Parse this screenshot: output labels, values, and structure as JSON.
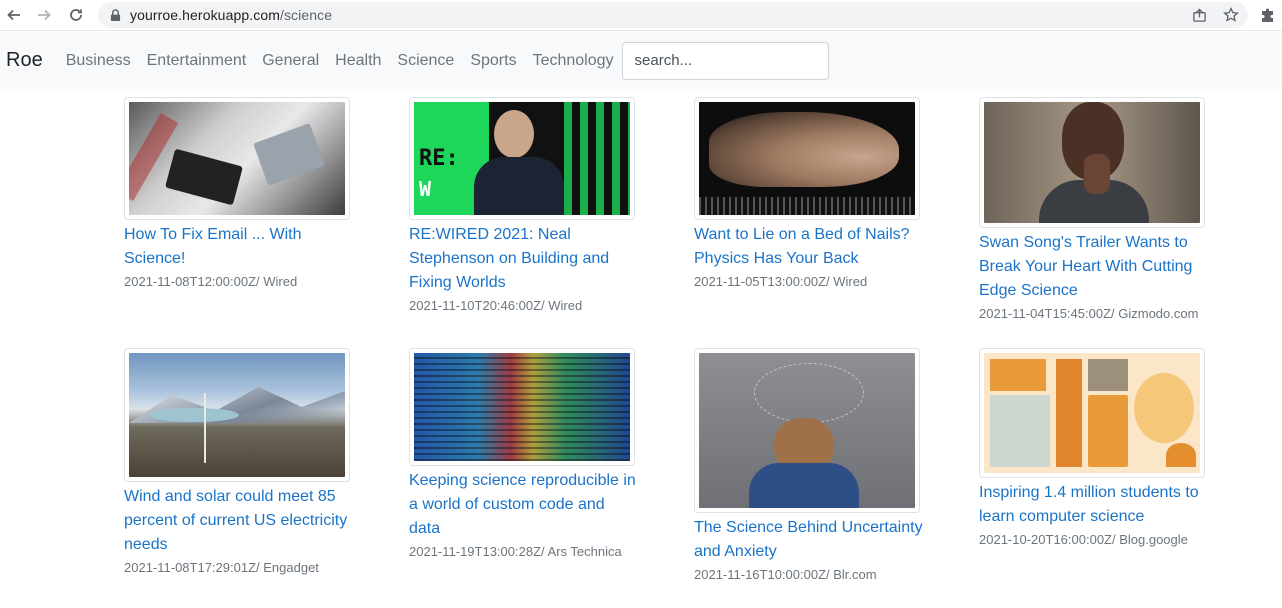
{
  "browser": {
    "url_host": "yourroe.herokuapp.com",
    "url_path": "/science"
  },
  "navbar": {
    "brand": "Roe",
    "links": [
      "Business",
      "Entertainment",
      "General",
      "Health",
      "Science",
      "Sports",
      "Technology"
    ],
    "search_placeholder": "search..."
  },
  "articles": [
    {
      "title": "How To Fix Email ... With Science!",
      "meta": "2021-11-08T12:00:00Z/ Wired"
    },
    {
      "title": "RE:WIRED 2021: Neal Stephenson on Building and Fixing Worlds",
      "meta": "2021-11-10T20:46:00Z/ Wired"
    },
    {
      "title": "Want to Lie on a Bed of Nails? Physics Has Your Back",
      "meta": "2021-11-05T13:00:00Z/ Wired"
    },
    {
      "title": "Swan Song's Trailer Wants to Break Your Heart With Cutting Edge Science",
      "meta": "2021-11-04T15:45:00Z/ Gizmodo.com"
    },
    {
      "title": "Wind and solar could meet 85 percent of current US electricity needs",
      "meta": "2021-11-08T17:29:01Z/ Engadget"
    },
    {
      "title": "Keeping science reproducible in a world of custom code and data",
      "meta": "2021-11-19T13:00:28Z/ Ars Technica"
    },
    {
      "title": "The Science Behind Uncertainty and Anxiety",
      "meta": "2021-11-16T10:00:00Z/ Blr.com"
    },
    {
      "title": "Inspiring 1.4 million students to learn computer science",
      "meta": "2021-10-20T16:00:00Z/ Blog.google"
    }
  ],
  "overlay_text": {
    "rewired_logo_re": "RE:",
    "rewired_logo_w": "W"
  }
}
